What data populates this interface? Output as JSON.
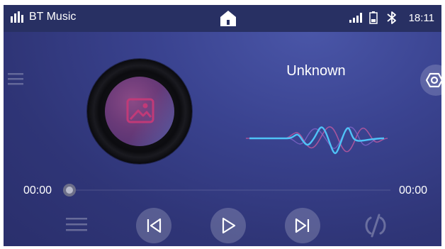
{
  "status_bar": {
    "app_title": "BT Music",
    "time": "18:11",
    "icons": [
      "equalizer-icon",
      "home-icon",
      "signal-icon",
      "battery-icon",
      "bluetooth-icon"
    ]
  },
  "track": {
    "title": "Unknown",
    "elapsed": "00:00",
    "duration": "00:00",
    "progress": 0
  },
  "controls": {
    "icons": [
      "playlist-icon",
      "previous-icon",
      "play-icon",
      "next-icon",
      "shuffle-icon"
    ]
  },
  "colors": {
    "background": "#2f3577",
    "status_bar": "#283063",
    "wave_blue": "#4fc3f7",
    "wave_pink": "#c05aa0"
  }
}
